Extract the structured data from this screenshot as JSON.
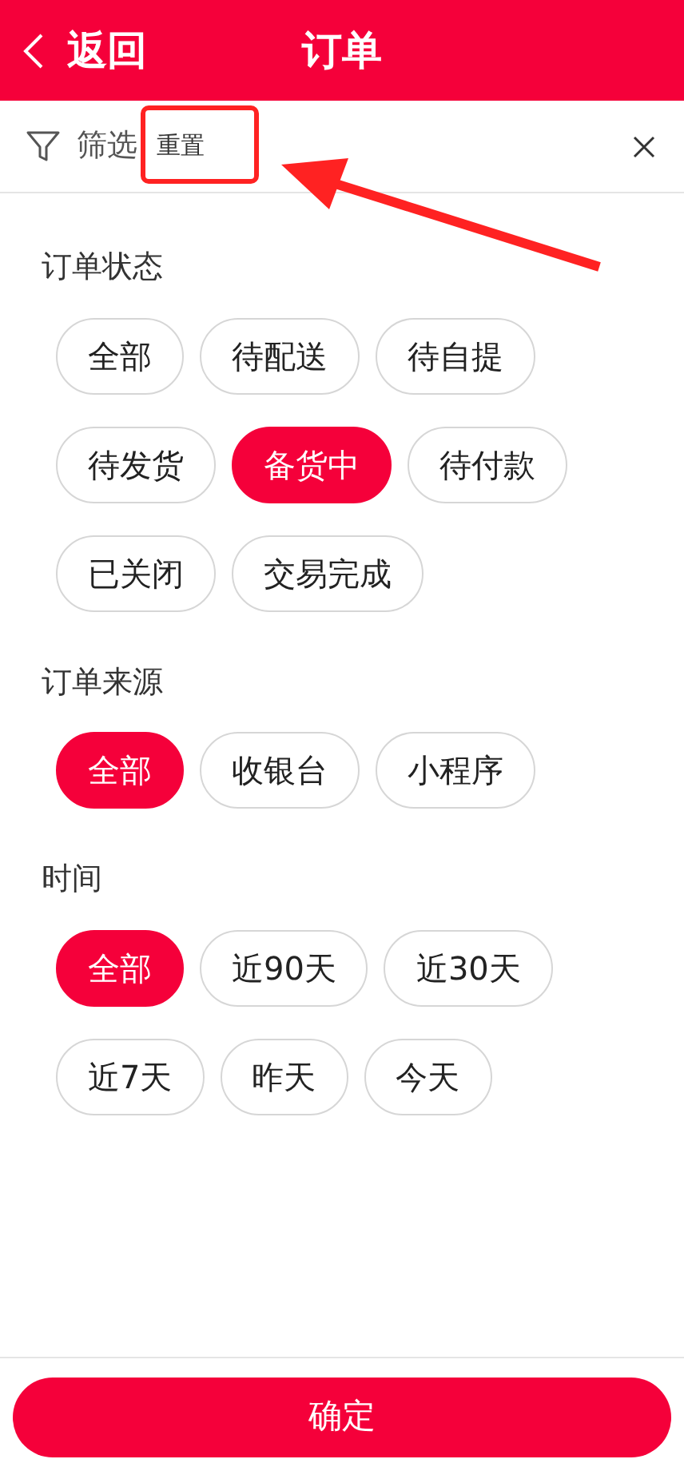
{
  "header": {
    "back_label": "返回",
    "title": "订单"
  },
  "filter_bar": {
    "label": "筛选",
    "reset_label": "重置",
    "reset_highlighted": true
  },
  "sections": [
    {
      "title": "订单状态",
      "options": [
        {
          "label": "全部",
          "selected": false
        },
        {
          "label": "待配送",
          "selected": false
        },
        {
          "label": "待自提",
          "selected": false
        },
        {
          "label": "待发货",
          "selected": false
        },
        {
          "label": "备货中",
          "selected": true
        },
        {
          "label": "待付款",
          "selected": false
        },
        {
          "label": "已关闭",
          "selected": false
        },
        {
          "label": "交易完成",
          "selected": false
        }
      ]
    },
    {
      "title": "订单来源",
      "options": [
        {
          "label": "全部",
          "selected": true
        },
        {
          "label": "收银台",
          "selected": false
        },
        {
          "label": "小程序",
          "selected": false
        }
      ]
    },
    {
      "title": "时间",
      "options": [
        {
          "label": "全部",
          "selected": true
        },
        {
          "label": "近90天",
          "selected": false
        },
        {
          "label": "近30天",
          "selected": false
        },
        {
          "label": "近7天",
          "selected": false
        },
        {
          "label": "昨天",
          "selected": false
        },
        {
          "label": "今天",
          "selected": false
        }
      ]
    }
  ],
  "confirm_label": "确定"
}
